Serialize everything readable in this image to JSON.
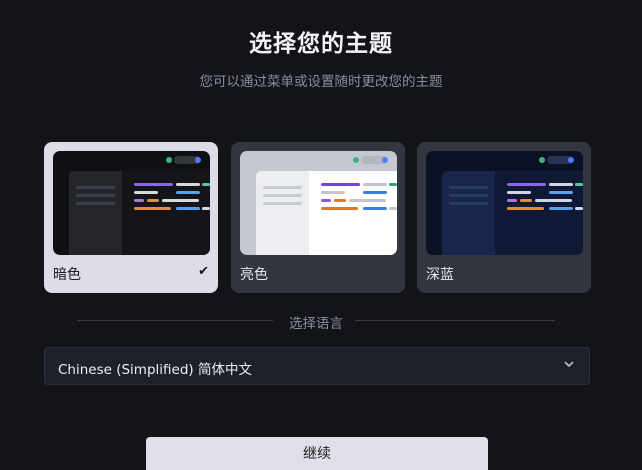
{
  "header": {
    "title": "选择您的主题",
    "subtitle": "您可以通过菜单或设置随时更改您的主题"
  },
  "themes": [
    {
      "label": "暗色",
      "selected": true,
      "preview": "dark"
    },
    {
      "label": "亮色",
      "selected": false,
      "preview": "light"
    },
    {
      "label": "深蓝",
      "selected": false,
      "preview": "deep-blue"
    }
  ],
  "selected_mark": "✔",
  "language": {
    "section_label": "选择语言",
    "selected_value": "Chinese (Simplified) 简体中文"
  },
  "continue_label": "继续",
  "colors": {
    "background": "#131419",
    "card_selected": "#dcdde6",
    "card_default": "#34363f",
    "accent_green": "#3fb37f",
    "accent_blue": "#4f7cf7"
  }
}
